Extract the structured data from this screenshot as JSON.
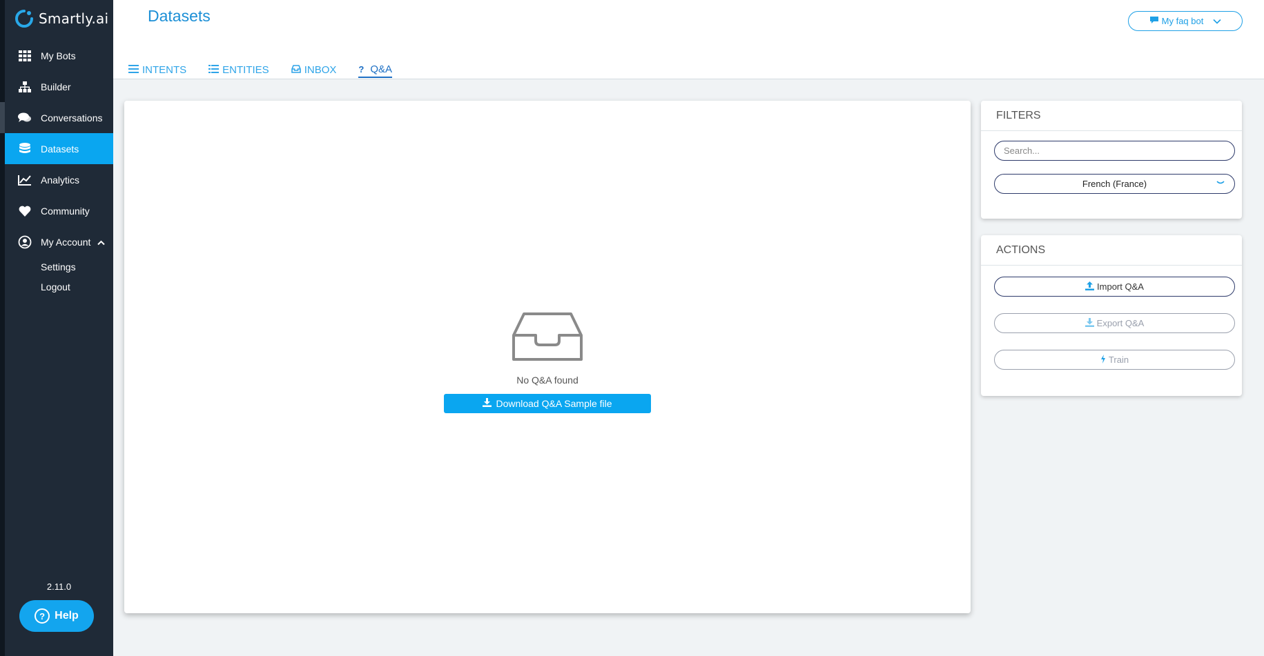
{
  "brand": {
    "name": "Smartly.ai",
    "tm": "™"
  },
  "sidebar": {
    "items": [
      {
        "label": "My Bots",
        "icon": "grid-icon"
      },
      {
        "label": "Builder",
        "icon": "sitemap-icon"
      },
      {
        "label": "Conversations",
        "icon": "comments-icon"
      },
      {
        "label": "Datasets",
        "icon": "database-icon",
        "active": true
      },
      {
        "label": "Analytics",
        "icon": "chart-line-icon"
      },
      {
        "label": "Community",
        "icon": "heart-icon"
      },
      {
        "label": "My Account",
        "icon": "user-circle-icon"
      }
    ],
    "account_sub": [
      "Settings",
      "Logout"
    ],
    "version": "2.11.0",
    "help_label": "Help"
  },
  "header": {
    "title": "Datasets",
    "bot_selector": "My faq bot"
  },
  "tabs": [
    {
      "label": "INTENTS",
      "icon": "list-icon"
    },
    {
      "label": "ENTITIES",
      "icon": "list-icon"
    },
    {
      "label": "INBOX",
      "icon": "inbox-icon"
    },
    {
      "label": "Q&A",
      "icon": "question-icon",
      "active": true
    }
  ],
  "main": {
    "empty_text": "No Q&A found",
    "download_label": "Download Q&A Sample file"
  },
  "filters": {
    "title": "FILTERS",
    "search_placeholder": "Search...",
    "language": "French (France)"
  },
  "actions": {
    "title": "ACTIONS",
    "import_label": "Import Q&A",
    "export_label": "Export Q&A",
    "train_label": "Train"
  },
  "colors": {
    "accent": "#0aa6f0",
    "sidebar": "#1f2a37",
    "title": "#1c8fd6"
  }
}
